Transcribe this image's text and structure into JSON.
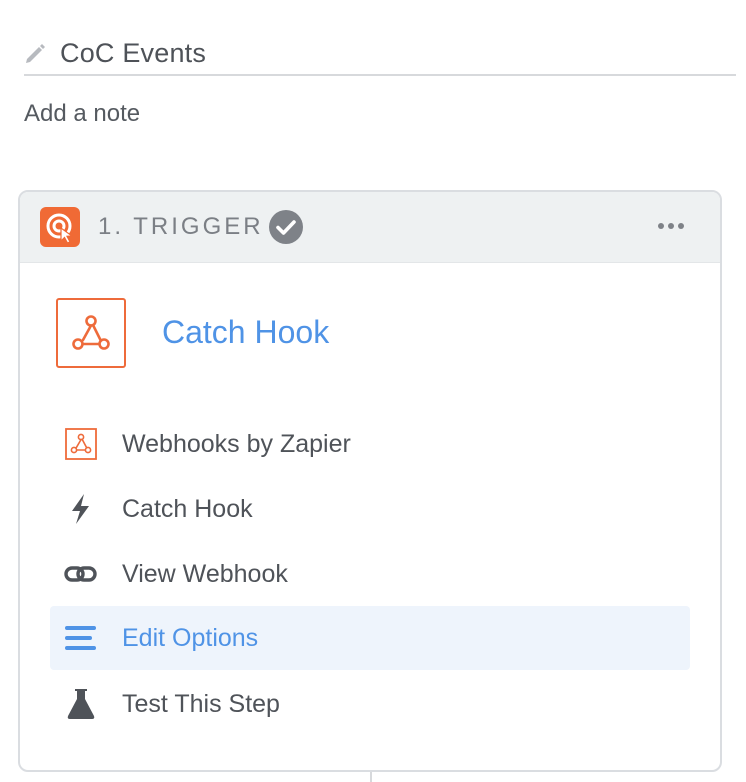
{
  "zap": {
    "title": "CoC Events",
    "add_note": "Add a note"
  },
  "step": {
    "label": "1. TRIGGER",
    "status": "complete",
    "event_title": "Catch Hook",
    "app_icon": "webhooks-icon",
    "accent_color": "#f06a35",
    "link_color": "#4f93e6",
    "items": [
      {
        "label": "Webhooks by Zapier",
        "icon": "webhooks-icon",
        "active": false
      },
      {
        "label": "Catch Hook",
        "icon": "bolt-icon",
        "active": false
      },
      {
        "label": "View Webhook",
        "icon": "link-icon",
        "active": false
      },
      {
        "label": "Edit Options",
        "icon": "list-icon",
        "active": true
      },
      {
        "label": "Test This Step",
        "icon": "flask-icon",
        "active": false
      }
    ]
  }
}
